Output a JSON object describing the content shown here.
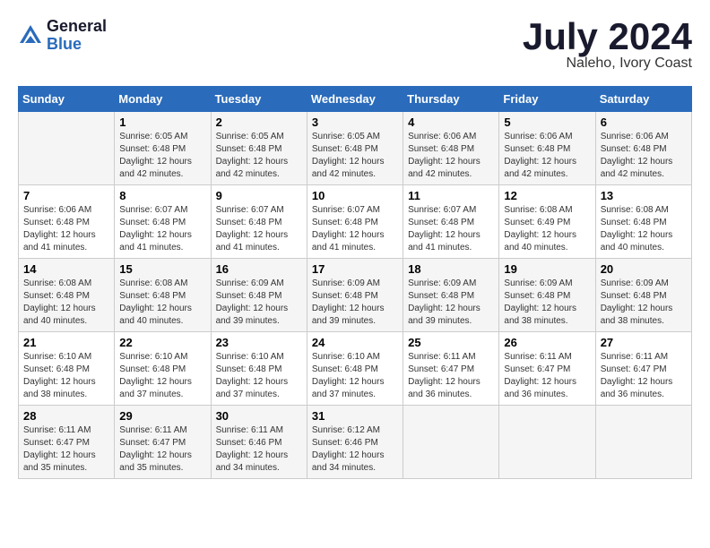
{
  "logo": {
    "general": "General",
    "blue": "Blue"
  },
  "title": {
    "month_year": "July 2024",
    "location": "Naleho, Ivory Coast"
  },
  "calendar": {
    "headers": [
      "Sunday",
      "Monday",
      "Tuesday",
      "Wednesday",
      "Thursday",
      "Friday",
      "Saturday"
    ],
    "weeks": [
      [
        {
          "day": "",
          "info": ""
        },
        {
          "day": "1",
          "info": "Sunrise: 6:05 AM\nSunset: 6:48 PM\nDaylight: 12 hours\nand 42 minutes."
        },
        {
          "day": "2",
          "info": "Sunrise: 6:05 AM\nSunset: 6:48 PM\nDaylight: 12 hours\nand 42 minutes."
        },
        {
          "day": "3",
          "info": "Sunrise: 6:05 AM\nSunset: 6:48 PM\nDaylight: 12 hours\nand 42 minutes."
        },
        {
          "day": "4",
          "info": "Sunrise: 6:06 AM\nSunset: 6:48 PM\nDaylight: 12 hours\nand 42 minutes."
        },
        {
          "day": "5",
          "info": "Sunrise: 6:06 AM\nSunset: 6:48 PM\nDaylight: 12 hours\nand 42 minutes."
        },
        {
          "day": "6",
          "info": "Sunrise: 6:06 AM\nSunset: 6:48 PM\nDaylight: 12 hours\nand 42 minutes."
        }
      ],
      [
        {
          "day": "7",
          "info": "Sunrise: 6:06 AM\nSunset: 6:48 PM\nDaylight: 12 hours\nand 41 minutes."
        },
        {
          "day": "8",
          "info": "Sunrise: 6:07 AM\nSunset: 6:48 PM\nDaylight: 12 hours\nand 41 minutes."
        },
        {
          "day": "9",
          "info": "Sunrise: 6:07 AM\nSunset: 6:48 PM\nDaylight: 12 hours\nand 41 minutes."
        },
        {
          "day": "10",
          "info": "Sunrise: 6:07 AM\nSunset: 6:48 PM\nDaylight: 12 hours\nand 41 minutes."
        },
        {
          "day": "11",
          "info": "Sunrise: 6:07 AM\nSunset: 6:48 PM\nDaylight: 12 hours\nand 41 minutes."
        },
        {
          "day": "12",
          "info": "Sunrise: 6:08 AM\nSunset: 6:49 PM\nDaylight: 12 hours\nand 40 minutes."
        },
        {
          "day": "13",
          "info": "Sunrise: 6:08 AM\nSunset: 6:48 PM\nDaylight: 12 hours\nand 40 minutes."
        }
      ],
      [
        {
          "day": "14",
          "info": "Sunrise: 6:08 AM\nSunset: 6:48 PM\nDaylight: 12 hours\nand 40 minutes."
        },
        {
          "day": "15",
          "info": "Sunrise: 6:08 AM\nSunset: 6:48 PM\nDaylight: 12 hours\nand 40 minutes."
        },
        {
          "day": "16",
          "info": "Sunrise: 6:09 AM\nSunset: 6:48 PM\nDaylight: 12 hours\nand 39 minutes."
        },
        {
          "day": "17",
          "info": "Sunrise: 6:09 AM\nSunset: 6:48 PM\nDaylight: 12 hours\nand 39 minutes."
        },
        {
          "day": "18",
          "info": "Sunrise: 6:09 AM\nSunset: 6:48 PM\nDaylight: 12 hours\nand 39 minutes."
        },
        {
          "day": "19",
          "info": "Sunrise: 6:09 AM\nSunset: 6:48 PM\nDaylight: 12 hours\nand 38 minutes."
        },
        {
          "day": "20",
          "info": "Sunrise: 6:09 AM\nSunset: 6:48 PM\nDaylight: 12 hours\nand 38 minutes."
        }
      ],
      [
        {
          "day": "21",
          "info": "Sunrise: 6:10 AM\nSunset: 6:48 PM\nDaylight: 12 hours\nand 38 minutes."
        },
        {
          "day": "22",
          "info": "Sunrise: 6:10 AM\nSunset: 6:48 PM\nDaylight: 12 hours\nand 37 minutes."
        },
        {
          "day": "23",
          "info": "Sunrise: 6:10 AM\nSunset: 6:48 PM\nDaylight: 12 hours\nand 37 minutes."
        },
        {
          "day": "24",
          "info": "Sunrise: 6:10 AM\nSunset: 6:48 PM\nDaylight: 12 hours\nand 37 minutes."
        },
        {
          "day": "25",
          "info": "Sunrise: 6:11 AM\nSunset: 6:47 PM\nDaylight: 12 hours\nand 36 minutes."
        },
        {
          "day": "26",
          "info": "Sunrise: 6:11 AM\nSunset: 6:47 PM\nDaylight: 12 hours\nand 36 minutes."
        },
        {
          "day": "27",
          "info": "Sunrise: 6:11 AM\nSunset: 6:47 PM\nDaylight: 12 hours\nand 36 minutes."
        }
      ],
      [
        {
          "day": "28",
          "info": "Sunrise: 6:11 AM\nSunset: 6:47 PM\nDaylight: 12 hours\nand 35 minutes."
        },
        {
          "day": "29",
          "info": "Sunrise: 6:11 AM\nSunset: 6:47 PM\nDaylight: 12 hours\nand 35 minutes."
        },
        {
          "day": "30",
          "info": "Sunrise: 6:11 AM\nSunset: 6:46 PM\nDaylight: 12 hours\nand 34 minutes."
        },
        {
          "day": "31",
          "info": "Sunrise: 6:12 AM\nSunset: 6:46 PM\nDaylight: 12 hours\nand 34 minutes."
        },
        {
          "day": "",
          "info": ""
        },
        {
          "day": "",
          "info": ""
        },
        {
          "day": "",
          "info": ""
        }
      ]
    ]
  }
}
